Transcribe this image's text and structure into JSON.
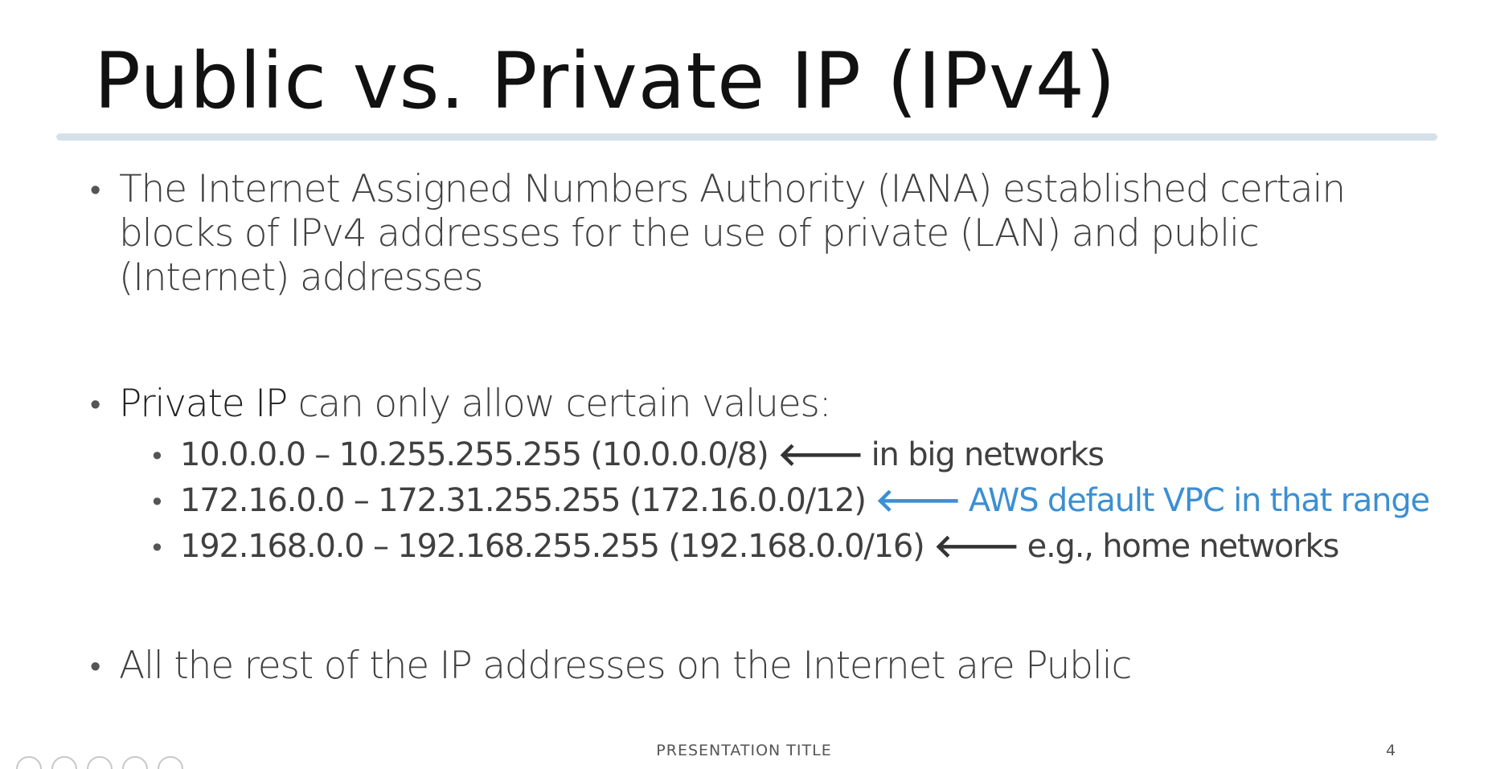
{
  "slide": {
    "title": "Public vs. Private IP (IPv4)",
    "bullets": {
      "iana": "The Internet Assigned Numbers Authority (IANA) established certain blocks of IPv4 addresses for the use of private (LAN) and public (Internet) addresses",
      "private_strong": "Private IP",
      "private_rest": " can only allow certain values:",
      "ranges": [
        {
          "range": "10.0.0.0 – 10.255.255.255  (10.0.0.0/8)",
          "note": "in big networks",
          "highlight": false
        },
        {
          "range": "172.16.0.0 – 172.31.255.255 (172.16.0.0/12)",
          "note": "AWS default VPC in that range",
          "highlight": true
        },
        {
          "range": "192.168.0.0 – 192.168.255.255 (192.168.0.0/16)",
          "note": "e.g., home networks",
          "highlight": false
        }
      ],
      "rest": "All the rest of the IP addresses on the Internet are Public"
    },
    "footer": "PRESENTATION TITLE",
    "page_number": "4",
    "bullet_glyph": "•",
    "sub_bullet_glyph": "•",
    "arrow_glyph": "🡐",
    "arrow_icon": "left-arrow-icon",
    "colors": {
      "title": "#111111",
      "text": "#404040",
      "accent": "#3c8fd3",
      "rule": "#d5e1ea"
    }
  }
}
